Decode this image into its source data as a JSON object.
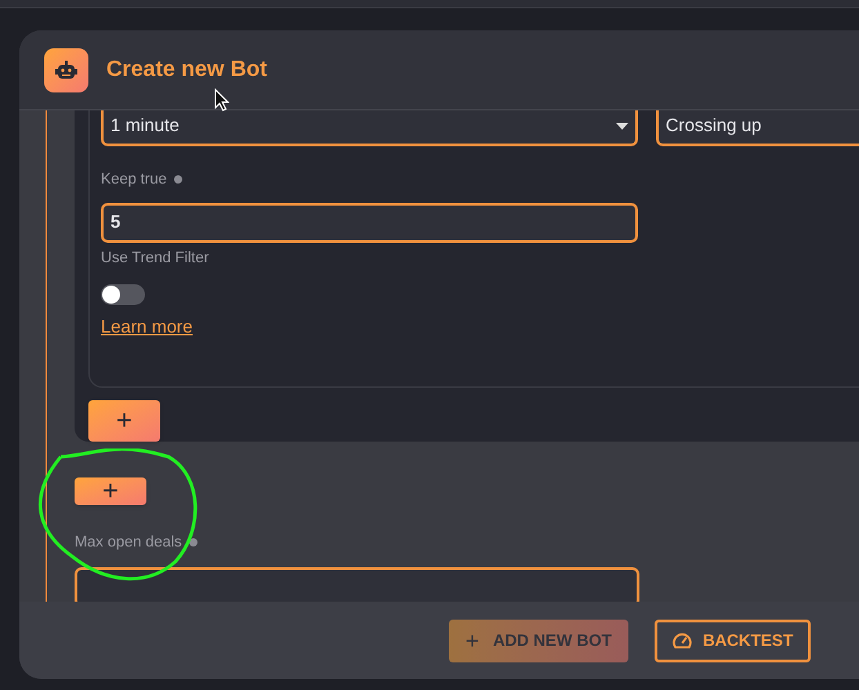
{
  "dialog": {
    "title": "Create new Bot"
  },
  "condition": {
    "timeframe": {
      "value": "1 minute"
    },
    "operator": {
      "value": "Crossing up"
    },
    "keep_true": {
      "label": "Keep true",
      "value": "5"
    },
    "trend_filter": {
      "label": "Use Trend Filter",
      "on": false
    },
    "learn_more": "Learn more",
    "add_button": "+"
  },
  "add_condition_button": "+",
  "max_open_deals": {
    "label": "Max open deals"
  },
  "footer": {
    "buttons": [
      {
        "kind": "add",
        "label": "ADD NEW BOT",
        "icon": "+",
        "disabled": true
      },
      {
        "kind": "backtest",
        "label": "BACKTEST",
        "disabled": false
      }
    ]
  }
}
